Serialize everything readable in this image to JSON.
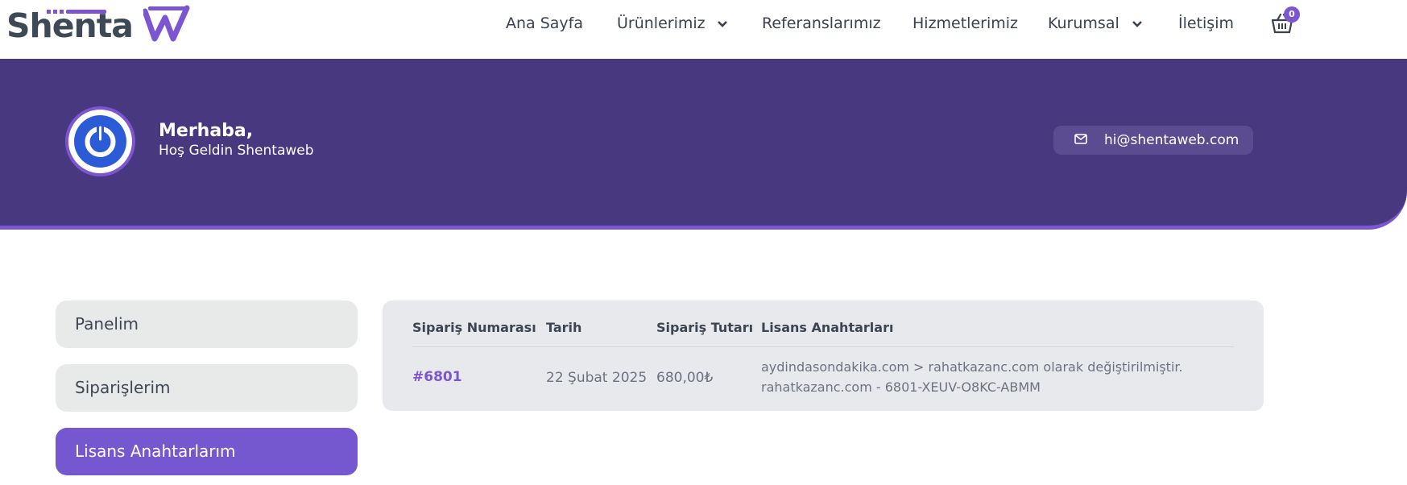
{
  "brand": {
    "name": "Shenta",
    "accent_color": "#7c55d1",
    "hero_color": "#48387f"
  },
  "nav": {
    "items": [
      {
        "label": "Ana Sayfa"
      },
      {
        "label": "Ürünlerimiz"
      },
      {
        "label": "Referanslarımız"
      },
      {
        "label": "Hizmetlerimiz"
      },
      {
        "label": "Kurumsal"
      },
      {
        "label": "İletişim"
      }
    ],
    "cart_count": "0",
    "cart_icon": "basket-icon"
  },
  "hero": {
    "greeting": "Merhaba,",
    "welcome": "Hoş Geldin Shentaweb",
    "email": "hi@shentaweb.com",
    "email_icon": "mail-icon"
  },
  "sidebar": {
    "items": [
      {
        "label": "Panelim",
        "active": false
      },
      {
        "label": "Siparişlerim",
        "active": false
      },
      {
        "label": "Lisans Anahtarlarım",
        "active": true
      }
    ]
  },
  "table": {
    "headers": [
      "Sipariş Numarası",
      "Tarih",
      "Sipariş Tutarı",
      "Lisans Anahtarları"
    ],
    "rows": [
      {
        "order_no": "#6801",
        "date": "22 Şubat 2025",
        "amount": "680,00₺",
        "license_line1": "aydindasondakika.com > rahatkazanc.com olarak değiştirilmiştir.",
        "license_line2": "rahatkazanc.com - 6801-XEUV-O8KC-ABMM"
      }
    ]
  }
}
